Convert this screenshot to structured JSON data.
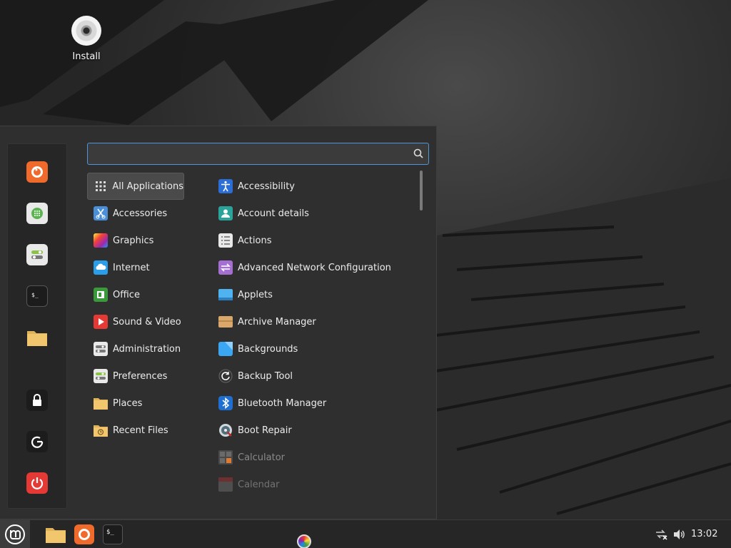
{
  "desktop": {
    "install_label": "Install"
  },
  "menu": {
    "search": {
      "value": "",
      "placeholder": ""
    },
    "favorites": [
      {
        "name": "firefox-icon"
      },
      {
        "name": "software-manager-icon"
      },
      {
        "name": "system-settings-icon"
      },
      {
        "name": "terminal-icon"
      },
      {
        "name": "files-icon"
      },
      {
        "name": "lock-screen-icon"
      },
      {
        "name": "logout-icon"
      },
      {
        "name": "shutdown-icon"
      }
    ],
    "categories": [
      {
        "label": "All Applications",
        "icon": "grid-icon",
        "selected": true
      },
      {
        "label": "Accessories",
        "icon": "scissors-icon"
      },
      {
        "label": "Graphics",
        "icon": "graphics-icon"
      },
      {
        "label": "Internet",
        "icon": "cloud-icon"
      },
      {
        "label": "Office",
        "icon": "office-icon"
      },
      {
        "label": "Sound & Video",
        "icon": "play-icon"
      },
      {
        "label": "Administration",
        "icon": "admin-icon"
      },
      {
        "label": "Preferences",
        "icon": "preferences-icon"
      },
      {
        "label": "Places",
        "icon": "folder-icon"
      },
      {
        "label": "Recent Files",
        "icon": "recent-folder-icon"
      }
    ],
    "apps": [
      {
        "label": "Accessibility",
        "icon": "accessibility-icon"
      },
      {
        "label": "Account details",
        "icon": "account-icon"
      },
      {
        "label": "Actions",
        "icon": "actions-icon"
      },
      {
        "label": "Advanced Network Configuration",
        "icon": "network-config-icon"
      },
      {
        "label": "Applets",
        "icon": "applets-icon"
      },
      {
        "label": "Archive Manager",
        "icon": "archive-icon"
      },
      {
        "label": "Backgrounds",
        "icon": "backgrounds-icon"
      },
      {
        "label": "Backup Tool",
        "icon": "backup-icon"
      },
      {
        "label": "Bluetooth Manager",
        "icon": "bluetooth-icon"
      },
      {
        "label": "Boot Repair",
        "icon": "boot-repair-icon"
      },
      {
        "label": "Calculator",
        "icon": "calculator-icon"
      },
      {
        "label": "Calendar",
        "icon": "calendar-icon"
      }
    ]
  },
  "taskbar": {
    "clock": "13:02",
    "launchers": [
      "files-icon",
      "firefox-icon",
      "terminal-icon"
    ]
  },
  "colors": {
    "accent": "#4d97d8",
    "panel": "#2f2f2f",
    "taskbar": "#262626"
  }
}
